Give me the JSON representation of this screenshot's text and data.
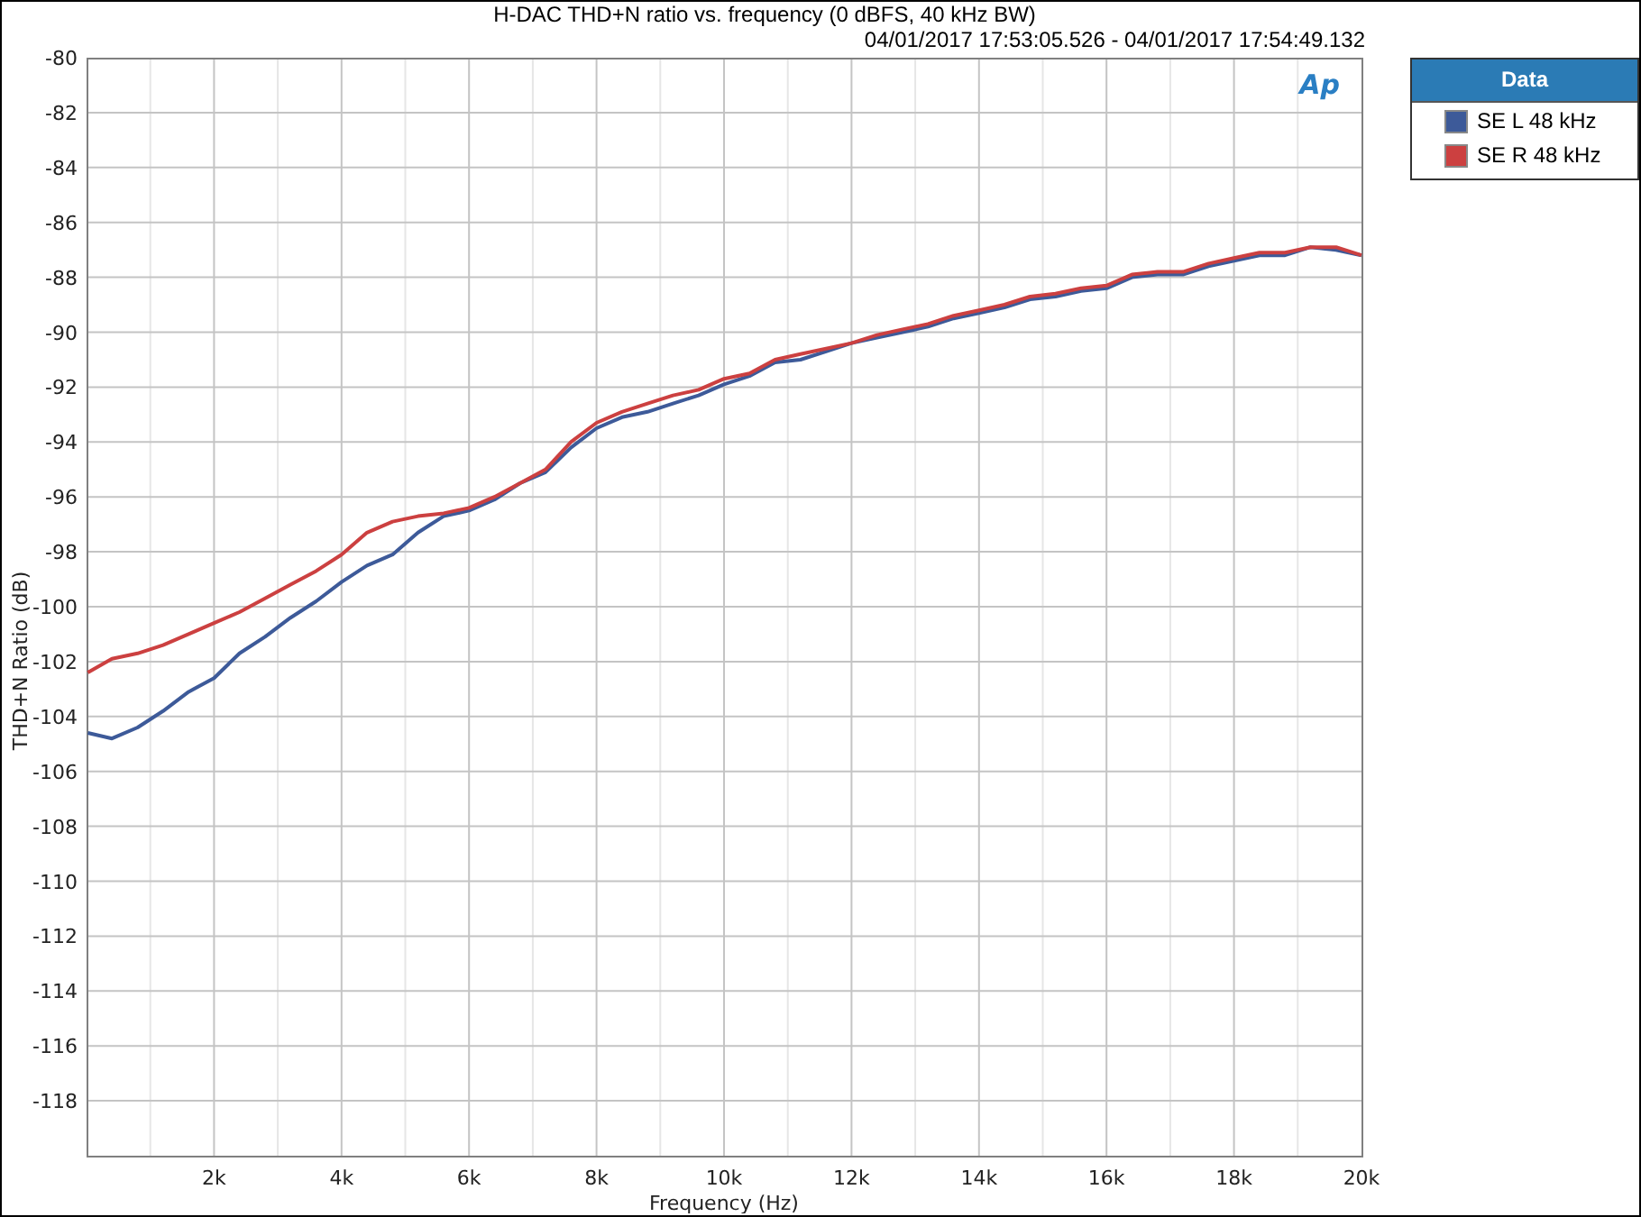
{
  "chart": {
    "title": "H-DAC THD+N ratio vs. frequency (0 dBFS, 40 kHz BW)",
    "time_range": "04/01/2017 17:53:05.526 - 04/01/2017 17:54:49.132",
    "logo": "Ap",
    "chart_data": {
      "type": "line",
      "grid": true,
      "xlabel": "Frequency (Hz)",
      "ylabel": "THD+N Ratio (dB)",
      "xlim": [
        0,
        20000
      ],
      "ylim": [
        -120,
        -80
      ],
      "xticks": [
        {
          "value": 2000,
          "label": "2k"
        },
        {
          "value": 4000,
          "label": "4k"
        },
        {
          "value": 6000,
          "label": "6k"
        },
        {
          "value": 8000,
          "label": "8k"
        },
        {
          "value": 10000,
          "label": "10k"
        },
        {
          "value": 12000,
          "label": "12k"
        },
        {
          "value": 14000,
          "label": "14k"
        },
        {
          "value": 16000,
          "label": "16k"
        },
        {
          "value": 18000,
          "label": "18k"
        },
        {
          "value": 20000,
          "label": "20k"
        }
      ],
      "yticks": [
        -118,
        -116,
        -114,
        -112,
        -110,
        -108,
        -106,
        -104,
        -102,
        -100,
        -98,
        -96,
        -94,
        -92,
        -90,
        -88,
        -86,
        -84,
        -82,
        -80
      ],
      "x": [
        20,
        400,
        800,
        1200,
        1600,
        2000,
        2400,
        2800,
        3200,
        3600,
        4000,
        4400,
        4800,
        5200,
        5600,
        6000,
        6400,
        6800,
        7200,
        7600,
        8000,
        8400,
        8800,
        9200,
        9600,
        10000,
        10400,
        10800,
        11200,
        11600,
        12000,
        12400,
        12800,
        13200,
        13600,
        14000,
        14400,
        14800,
        15200,
        15600,
        16000,
        16400,
        16800,
        17200,
        17600,
        18000,
        18400,
        18800,
        19200,
        19600,
        20000
      ],
      "series": [
        {
          "name": "SE L 48 kHz",
          "color": "#3d5a99",
          "values": [
            -104.6,
            -104.8,
            -104.4,
            -103.8,
            -103.1,
            -102.6,
            -101.7,
            -101.1,
            -100.4,
            -99.8,
            -99.1,
            -98.5,
            -98.1,
            -97.3,
            -96.7,
            -96.5,
            -96.1,
            -95.5,
            -95.1,
            -94.2,
            -93.5,
            -93.1,
            -92.9,
            -92.6,
            -92.3,
            -91.9,
            -91.6,
            -91.1,
            -91.0,
            -90.7,
            -90.4,
            -90.2,
            -90.0,
            -89.8,
            -89.5,
            -89.3,
            -89.1,
            -88.8,
            -88.7,
            -88.5,
            -88.4,
            -88.0,
            -87.9,
            -87.9,
            -87.6,
            -87.4,
            -87.2,
            -87.2,
            -86.9,
            -87.0,
            -87.2
          ]
        },
        {
          "name": "SE R 48 kHz",
          "color": "#cc4040",
          "values": [
            -102.4,
            -101.9,
            -101.7,
            -101.4,
            -101.0,
            -100.6,
            -100.2,
            -99.7,
            -99.2,
            -98.7,
            -98.1,
            -97.3,
            -96.9,
            -96.7,
            -96.6,
            -96.4,
            -96.0,
            -95.5,
            -95.0,
            -94.0,
            -93.3,
            -92.9,
            -92.6,
            -92.3,
            -92.1,
            -91.7,
            -91.5,
            -91.0,
            -90.8,
            -90.6,
            -90.4,
            -90.1,
            -89.9,
            -89.7,
            -89.4,
            -89.2,
            -89.0,
            -88.7,
            -88.6,
            -88.4,
            -88.3,
            -87.9,
            -87.8,
            -87.8,
            -87.5,
            -87.3,
            -87.1,
            -87.1,
            -86.9,
            -86.9,
            -87.2
          ]
        }
      ]
    }
  },
  "legend": {
    "title": "Data"
  }
}
